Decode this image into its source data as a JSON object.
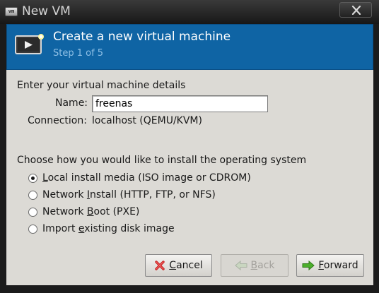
{
  "window": {
    "title": "New VM",
    "app_icon_text": "vm"
  },
  "header": {
    "title": "Create a new virtual machine",
    "step": "Step 1 of 5"
  },
  "details": {
    "section_label": "Enter your virtual machine details",
    "name_label": "Name:",
    "name_value": "freenas",
    "connection_label": "Connection:",
    "connection_value": "localhost (QEMU/KVM)"
  },
  "install": {
    "section_label": "Choose how you would like to install the operating system",
    "options": [
      {
        "prefix": "",
        "key": "L",
        "rest": "ocal install media (ISO image or CDROM)",
        "selected": true
      },
      {
        "prefix": "Network ",
        "key": "I",
        "rest": "nstall (HTTP, FTP, or NFS)",
        "selected": false
      },
      {
        "prefix": "Network ",
        "key": "B",
        "rest": "oot (PXE)",
        "selected": false
      },
      {
        "prefix": "Import ",
        "key": "e",
        "rest": "xisting disk image",
        "selected": false
      }
    ]
  },
  "buttons": {
    "cancel": {
      "key": "C",
      "rest": "ancel",
      "icon": "red-x-icon"
    },
    "back": {
      "key": "B",
      "rest": "ack",
      "icon": "back-arrow-icon",
      "enabled": false
    },
    "forward": {
      "key": "F",
      "rest": "orward",
      "icon": "forward-arrow-icon"
    }
  },
  "colors": {
    "banner": "#0f64a4",
    "banner_step": "#8fc0e6",
    "content_bg": "#dcdad5"
  }
}
